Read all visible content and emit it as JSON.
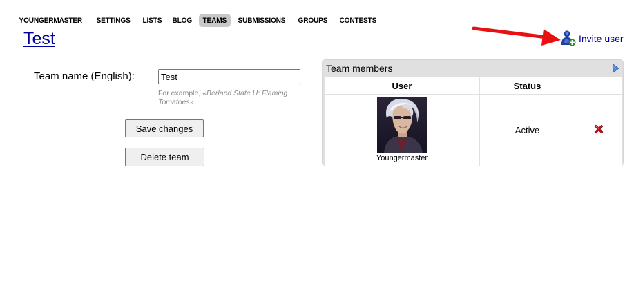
{
  "nav": {
    "items": [
      {
        "label": "YOUNGERMASTER",
        "active": false
      },
      {
        "label": "SETTINGS",
        "active": false
      },
      {
        "label": "LISTS",
        "active": false
      },
      {
        "label": "BLOG",
        "active": false
      },
      {
        "label": "TEAMS",
        "active": true
      },
      {
        "label": "SUBMISSIONS",
        "active": false
      },
      {
        "label": "GROUPS",
        "active": false
      },
      {
        "label": "CONTESTS",
        "active": false
      }
    ]
  },
  "page": {
    "title": "Test"
  },
  "invite": {
    "label": "Invite user",
    "icon": "add-user-icon"
  },
  "annotation": {
    "arrow_color": "#e81010"
  },
  "form": {
    "team_name_label": "Team name (English):",
    "team_name_value": "Test",
    "hint_prefix": "For example, «",
    "hint_example": "Berland State U: Flaming Tomatoes",
    "hint_suffix": "»",
    "save_label": "Save changes",
    "delete_label": "Delete team"
  },
  "members": {
    "title": "Team members",
    "columns": [
      "User",
      "Status",
      ""
    ],
    "rows": [
      {
        "user": "Youngermaster",
        "status": "Active",
        "avatar": "avatar",
        "action_icon": "remove-icon"
      }
    ]
  },
  "colors": {
    "link": "#0000a0",
    "active_tab": "#c8c8c8",
    "panel_bg": "#e0e0e0",
    "hint_text": "#888888",
    "remove_icon": "#c0101a"
  }
}
